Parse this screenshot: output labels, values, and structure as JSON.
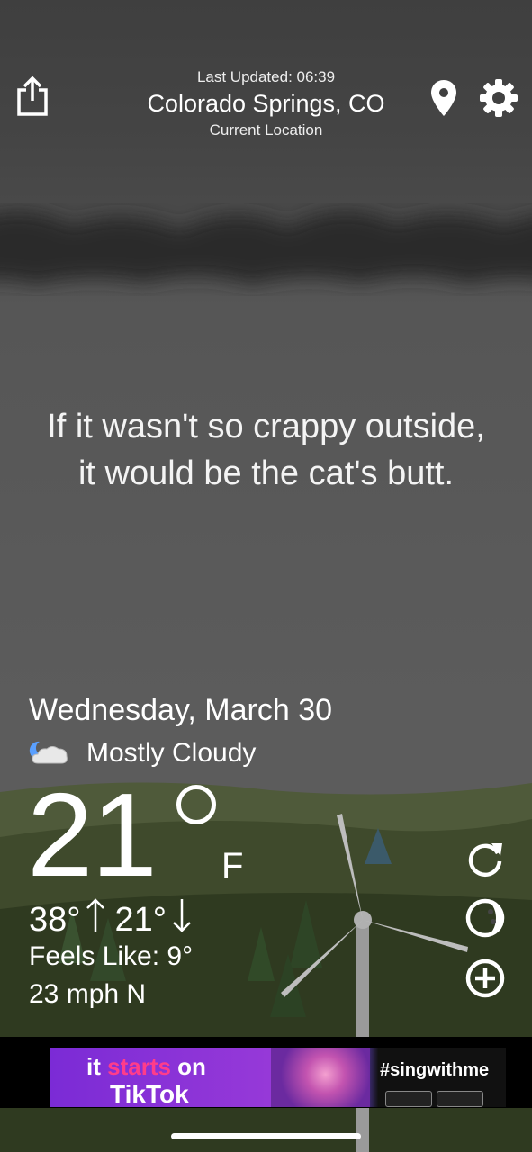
{
  "header": {
    "last_updated": "Last Updated: 06:39",
    "city": "Colorado Springs, CO",
    "location_label": "Current Location"
  },
  "quote": "If it wasn't so crappy outside, it would be the cat's butt.",
  "weather": {
    "date": "Wednesday, March 30",
    "condition": "Mostly Cloudy",
    "condition_icon": "moon-cloud-icon",
    "temperature": "21",
    "unit": "F",
    "high": "38°",
    "low": "21°",
    "feels_like": "Feels Like: 9°",
    "wind": "23 mph N"
  },
  "icons": {
    "share": "share-icon",
    "location": "location-pin-icon",
    "settings": "gear-icon",
    "refresh": "refresh-icon",
    "radar": "radar-icon",
    "add": "plus-circle-icon"
  },
  "ad": {
    "headline_part1": "it ",
    "headline_part2": "starts",
    "headline_part3": " on",
    "brand": "TikTok",
    "hashtag": "#singwithme"
  }
}
